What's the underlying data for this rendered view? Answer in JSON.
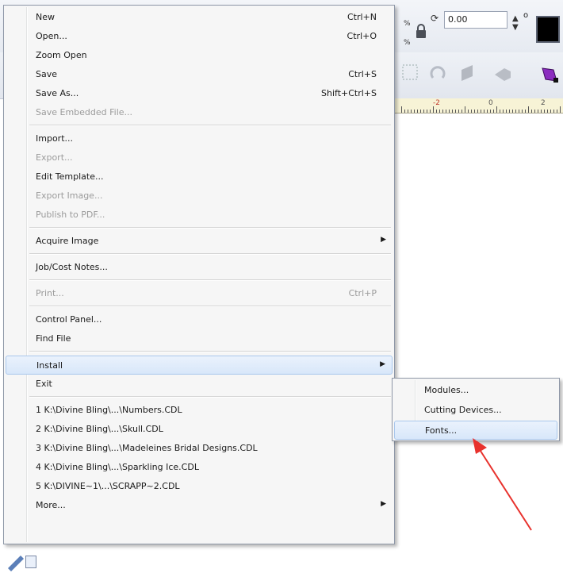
{
  "toolbar": {
    "rotation_value": "0.00",
    "ruler_labels": [
      "-2",
      "0",
      "2"
    ]
  },
  "file_menu": {
    "groups": [
      [
        {
          "label": "New",
          "shortcut": "Ctrl+N",
          "enabled": true
        },
        {
          "label": "Open...",
          "shortcut": "Ctrl+O",
          "enabled": true
        },
        {
          "label": "Zoom Open",
          "shortcut": "",
          "enabled": true
        },
        {
          "label": "Save",
          "shortcut": "Ctrl+S",
          "enabled": true
        },
        {
          "label": "Save As...",
          "shortcut": "Shift+Ctrl+S",
          "enabled": true
        },
        {
          "label": "Save Embedded File...",
          "shortcut": "",
          "enabled": false
        }
      ],
      [
        {
          "label": "Import...",
          "shortcut": "",
          "enabled": true
        },
        {
          "label": "Export...",
          "shortcut": "",
          "enabled": false
        },
        {
          "label": "Edit Template...",
          "shortcut": "",
          "enabled": true
        },
        {
          "label": "Export Image...",
          "shortcut": "",
          "enabled": false
        },
        {
          "label": "Publish to PDF...",
          "shortcut": "",
          "enabled": false
        }
      ],
      [
        {
          "label": "Acquire Image",
          "shortcut": "",
          "enabled": true,
          "submenu": true
        }
      ],
      [
        {
          "label": "Job/Cost Notes...",
          "shortcut": "",
          "enabled": true
        }
      ],
      [
        {
          "label": "Print...",
          "shortcut": "Ctrl+P",
          "enabled": false
        }
      ],
      [
        {
          "label": "Control Panel...",
          "shortcut": "",
          "enabled": true
        },
        {
          "label": "Find File",
          "shortcut": "",
          "enabled": true
        }
      ],
      [
        {
          "label": "Install",
          "shortcut": "",
          "enabled": true,
          "submenu": true,
          "highlighted": true
        },
        {
          "label": "Exit",
          "shortcut": "",
          "enabled": true
        }
      ],
      [
        {
          "label": "1 K:\\Divine Bling\\...\\Numbers.CDL",
          "shortcut": "",
          "enabled": true
        },
        {
          "label": "2 K:\\Divine Bling\\...\\Skull.CDL",
          "shortcut": "",
          "enabled": true
        },
        {
          "label": "3 K:\\Divine Bling\\...\\Madeleines Bridal Designs.CDL",
          "shortcut": "",
          "enabled": true
        },
        {
          "label": "4 K:\\Divine Bling\\...\\Sparkling Ice.CDL",
          "shortcut": "",
          "enabled": true
        },
        {
          "label": "5 K:\\DIVINE~1\\...\\SCRAPP~2.CDL",
          "shortcut": "",
          "enabled": true
        },
        {
          "label": "More...",
          "shortcut": "",
          "enabled": true,
          "submenu": true
        }
      ]
    ]
  },
  "install_submenu": {
    "items": [
      {
        "label": "Modules...",
        "highlighted": false
      },
      {
        "label": "Cutting Devices...",
        "highlighted": false
      },
      {
        "label": "Fonts...",
        "highlighted": true
      }
    ]
  },
  "colors": {
    "highlight_border": "#a9c7ec",
    "annotation_arrow": "#e8322d",
    "disabled_text": "#9b9b9b"
  }
}
